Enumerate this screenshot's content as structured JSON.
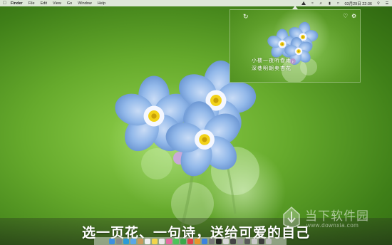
{
  "menubar": {
    "apple_icon": "apple-icon",
    "app_name": "Finder",
    "menus": [
      "File",
      "Edit",
      "View",
      "Go",
      "Window",
      "Help"
    ],
    "clock": "03月29日 22:36"
  },
  "popup": {
    "refresh_icon": "refresh-icon",
    "heart_icon": "heart-icon",
    "settings_icon": "settings-icon",
    "poem_line_1": "小楼一夜听春雨，",
    "poem_line_2": "深巷明朝卖杏花"
  },
  "caption": "选一页花、一句诗，送给可爱的自己",
  "watermark": {
    "name": "当下软件园",
    "url": "www.downxia.com"
  },
  "colors": {
    "background_green": "#66aa2c",
    "flower_blue": "#8fb8ea",
    "flower_center": "#f2d21a"
  }
}
